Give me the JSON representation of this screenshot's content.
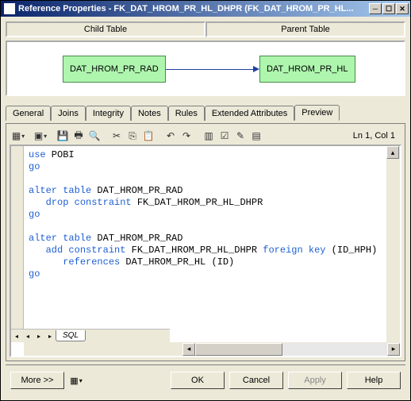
{
  "window": {
    "title": "Reference Properties - FK_DAT_HROM_PR_HL_DHPR (FK_DAT_HROM_PR_HL..."
  },
  "tables": {
    "child_label": "Child Table",
    "parent_label": "Parent Table",
    "child_entity": "DAT_HROM_PR_RAD",
    "parent_entity": "DAT_HROM_PR_HL"
  },
  "tabs": {
    "items": [
      {
        "label": "General"
      },
      {
        "label": "Joins"
      },
      {
        "label": "Integrity"
      },
      {
        "label": "Notes"
      },
      {
        "label": "Rules"
      },
      {
        "label": "Extended Attributes"
      },
      {
        "label": "Preview"
      }
    ],
    "active_index": 6
  },
  "editor": {
    "position": "Ln 1, Col 1",
    "sql_tab_label": "SQL",
    "code_lines": [
      {
        "kw": "use",
        "rest": " POBI"
      },
      {
        "kw": "go",
        "rest": ""
      },
      {
        "kw": "",
        "rest": ""
      },
      {
        "kw": "alter table",
        "rest": " DAT_HROM_PR_RAD"
      },
      {
        "indent": "   ",
        "kw": "drop constraint",
        "rest": " FK_DAT_HROM_PR_HL_DHPR"
      },
      {
        "kw": "go",
        "rest": ""
      },
      {
        "kw": "",
        "rest": ""
      },
      {
        "kw": "alter table",
        "rest": " DAT_HROM_PR_RAD"
      },
      {
        "indent": "   ",
        "kw": "add constraint",
        "rest": " FK_DAT_HROM_PR_HL_DHPR ",
        "kw2": "foreign key",
        "rest2": " (ID_HPH)"
      },
      {
        "indent": "      ",
        "kw": "references",
        "rest": " DAT_HROM_PR_HL (ID)"
      },
      {
        "kw": "go",
        "rest": ""
      }
    ]
  },
  "footer": {
    "more": "More >>",
    "ok": "OK",
    "cancel": "Cancel",
    "apply": "Apply",
    "help": "Help"
  }
}
